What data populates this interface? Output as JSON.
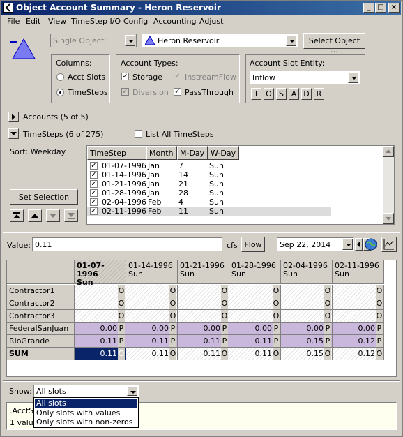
{
  "window": {
    "title": "Object Account Summary - Heron Reservoir"
  },
  "menu": [
    "File",
    "Edit",
    "View",
    "TimeStep I/O",
    "Config",
    "Accounting",
    "Adjust"
  ],
  "object_mode": "Single Object:",
  "object_name": "Heron Reservoir",
  "select_object_label": "Select Object ...",
  "columns": {
    "label": "Columns:",
    "acct_slots": "Acct Slots",
    "timesteps": "TimeSteps",
    "selected": "TimeSteps"
  },
  "account_types": {
    "label": "Account Types:",
    "storage": {
      "label": "Storage",
      "checked": true,
      "enabled": true
    },
    "diversion": {
      "label": "Diversion",
      "checked": true,
      "enabled": false
    },
    "instreamflow": {
      "label": "InstreamFlow",
      "checked": true,
      "enabled": false
    },
    "passthrough": {
      "label": "PassThrough",
      "checked": true,
      "enabled": true
    }
  },
  "slot_entity": {
    "label": "Account Slot Entity:",
    "value": "Inflow",
    "buttons": [
      "I",
      "O",
      "S",
      "A",
      "D",
      "R"
    ]
  },
  "accounts_toggle": "Accounts  (5 of 5)",
  "timesteps_toggle": "TimeSteps  (6 of 275)",
  "list_all": "List All TimeSteps",
  "sort_label": "Sort: Weekday",
  "set_selection": "Set Selection",
  "ts_list": {
    "headers": [
      "TimeStep",
      "Month",
      "M-Day",
      "W-Day"
    ],
    "rows": [
      [
        "01-07-1996",
        "Jan",
        "7",
        "Sun"
      ],
      [
        "01-14-1996",
        "Jan",
        "14",
        "Sun"
      ],
      [
        "01-21-1996",
        "Jan",
        "21",
        "Sun"
      ],
      [
        "01-28-1996",
        "Jan",
        "28",
        "Sun"
      ],
      [
        "02-04-1996",
        "Feb",
        "4",
        "Sun"
      ],
      [
        "02-11-1996",
        "Feb",
        "11",
        "Sun"
      ]
    ]
  },
  "value_row": {
    "label": "Value:",
    "value": "0.11",
    "unit": "cfs",
    "type": "Flow",
    "date": "Sep 22, 2014"
  },
  "grid": {
    "columns": [
      {
        "date": "01-07-1996",
        "day": "Sun"
      },
      {
        "date": "01-14-1996",
        "day": "Sun"
      },
      {
        "date": "01-21-1996",
        "day": "Sun"
      },
      {
        "date": "01-28-1996",
        "day": "Sun"
      },
      {
        "date": "02-04-1996",
        "day": "Sun"
      },
      {
        "date": "02-11-1996",
        "day": "Sun"
      }
    ],
    "rows": [
      {
        "name": "Contractor1",
        "values": [
          "",
          "",
          "",
          "",
          "",
          ""
        ],
        "flag": "O"
      },
      {
        "name": "Contractor2",
        "values": [
          "",
          "",
          "",
          "",
          "",
          ""
        ],
        "flag": "O"
      },
      {
        "name": "Contractor3",
        "values": [
          "",
          "",
          "",
          "",
          "",
          ""
        ],
        "flag": "O"
      },
      {
        "name": "FederalSanJuan",
        "values": [
          "0.00",
          "0.00",
          "0.00",
          "0.00",
          "0.00",
          "0.00"
        ],
        "flag": "P"
      },
      {
        "name": "RioGrande",
        "values": [
          "0.11",
          "0.11",
          "0.11",
          "0.11",
          "0.15",
          "0.12"
        ],
        "flag": "P"
      },
      {
        "name": "SUM",
        "values": [
          "0.11",
          "0.11",
          "0.11",
          "0.11",
          "0.15",
          "0.12"
        ],
        "flag": "O"
      }
    ]
  },
  "show": {
    "label": "Show:",
    "value": "All slots",
    "options": [
      "All slots",
      "Only slots with values",
      "Only slots with non-zeros"
    ]
  },
  "status": {
    "line1": ".AcctS",
    "line2": "1 value"
  },
  "colors": {
    "title_start": "#0a246a",
    "purple_cell": "#c9b8dc",
    "selected_cell": "#0a246a"
  }
}
